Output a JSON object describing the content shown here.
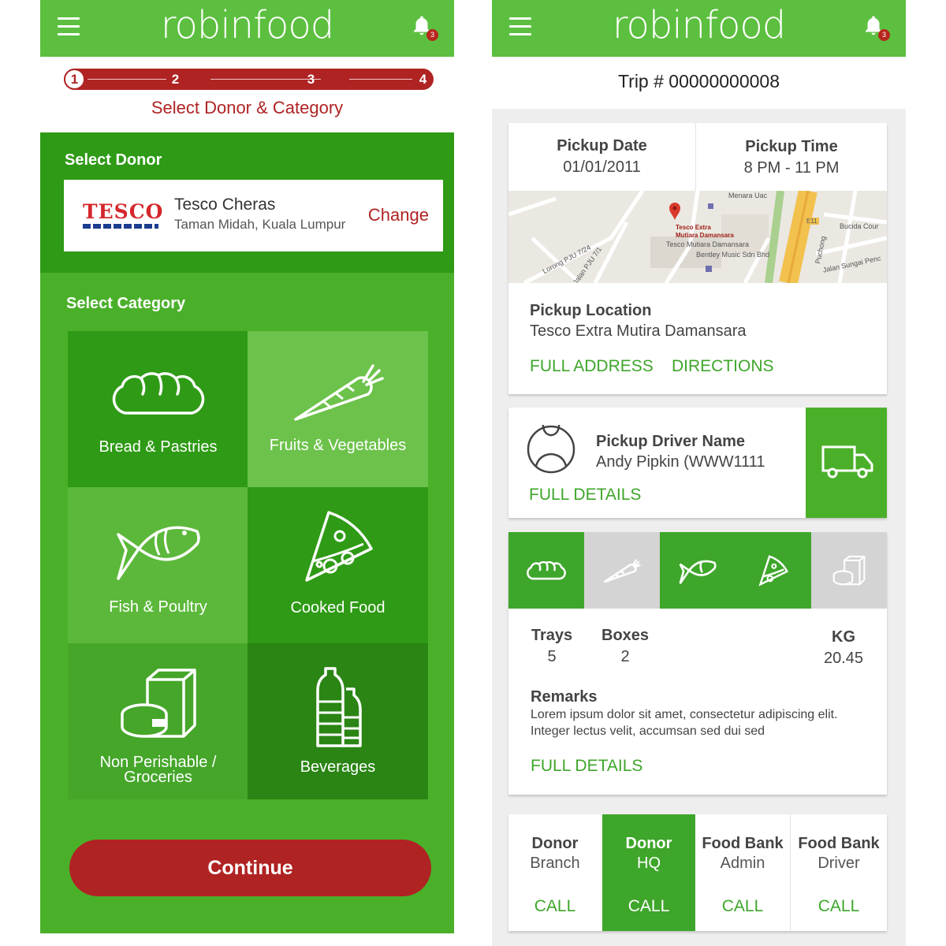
{
  "app": {
    "logo_text": "robinfood",
    "notification_count": "3"
  },
  "left": {
    "steps": [
      "1",
      "2",
      "3",
      "4"
    ],
    "step_title": "Select Donor & Category",
    "select_donor_label": "Select  Donor",
    "donor": {
      "brand": "TESCO",
      "name": "Tesco Cheras",
      "address": "Taman Midah, Kuala Lumpur",
      "change_label": "Change"
    },
    "select_category_label": "Select  Category",
    "categories": [
      {
        "label": "Bread & Pastries",
        "icon": "bread-icon",
        "color": "#2e9a15"
      },
      {
        "label": "Fruits & Vegetables",
        "icon": "carrot-icon",
        "color": "#6cc24a"
      },
      {
        "label": "Fish & Poultry",
        "icon": "fish-icon",
        "color": "#5cb83a"
      },
      {
        "label": "Cooked Food",
        "icon": "pizza-icon",
        "color": "#2e9a15"
      },
      {
        "label": "Non Perishable /",
        "label2": "Groceries",
        "icon": "groceries-icon",
        "color": "#45a62a"
      },
      {
        "label": "Beverages",
        "icon": "bottles-icon",
        "color": "#2a8514"
      }
    ],
    "continue_label": "Continue"
  },
  "right": {
    "trip_label": "Trip # 00000000008",
    "pickup_date_label": "Pickup Date",
    "pickup_date": "01/01/2011",
    "pickup_time_label": "Pickup Time",
    "pickup_time": "8 PM - 11 PM",
    "map_labels": {
      "menara": "Menara Uac",
      "tesco_extra": "Tesco Extra",
      "mutiara": "Mutiara Damansara",
      "tesco_mutiara": "Tesco Mutiara Damansara",
      "bentley": "Bentley Music Sdn Bhd",
      "bucida": "Bucida Cour",
      "puchong": "Puchong",
      "jalan_sungai": "Jalan Sungai Penc",
      "lorong": "Lorong PJU 7/24",
      "jalan_pju": "Jalan PJU 7/1",
      "e11": "E11"
    },
    "pickup_location_label": "Pickup Location",
    "pickup_location": "Tesco Extra Mutira Damansara",
    "full_address_label": "FULL ADDRESS",
    "directions_label": "DIRECTIONS",
    "driver_name_label": "Pickup Driver Name",
    "driver_name": "Andy Pipkin (WWW1111",
    "full_details_label": "FULL DETAILS",
    "category_flags": [
      {
        "icon": "bread-icon",
        "selected": true
      },
      {
        "icon": "carrot-icon",
        "selected": false
      },
      {
        "icon": "fish-icon",
        "selected": true
      },
      {
        "icon": "pizza-icon",
        "selected": true
      },
      {
        "icon": "groceries-icon",
        "selected": false
      }
    ],
    "trays_label": "Trays",
    "trays": "5",
    "boxes_label": "Boxes",
    "boxes": "2",
    "kg_label": "KG",
    "kg": "20.45",
    "remarks_label": "Remarks",
    "remarks_line1": "Lorem ipsum dolor sit amet, consectetur adipiscing elit.",
    "remarks_line2": "Integer lectus velit, accumsan sed dui sed",
    "full_details_label2": "FULL DETAILS",
    "contacts": [
      {
        "line1": "Donor",
        "line2": "Branch",
        "call": "CALL",
        "active": false
      },
      {
        "line1": "Donor",
        "line2": "HQ",
        "call": "CALL",
        "active": true
      },
      {
        "line1": "Food Bank",
        "line2": "Admin",
        "call": "CALL",
        "active": false
      },
      {
        "line1": "Food Bank",
        "line2": "Driver",
        "call": "CALL",
        "active": false
      }
    ]
  },
  "colors": {
    "brand_green": "#5cbf3f",
    "dark_green": "#2e9a15",
    "accent_red": "#b02323",
    "link_green": "#3ea62a",
    "inactive_gray": "#d4d4d4"
  }
}
